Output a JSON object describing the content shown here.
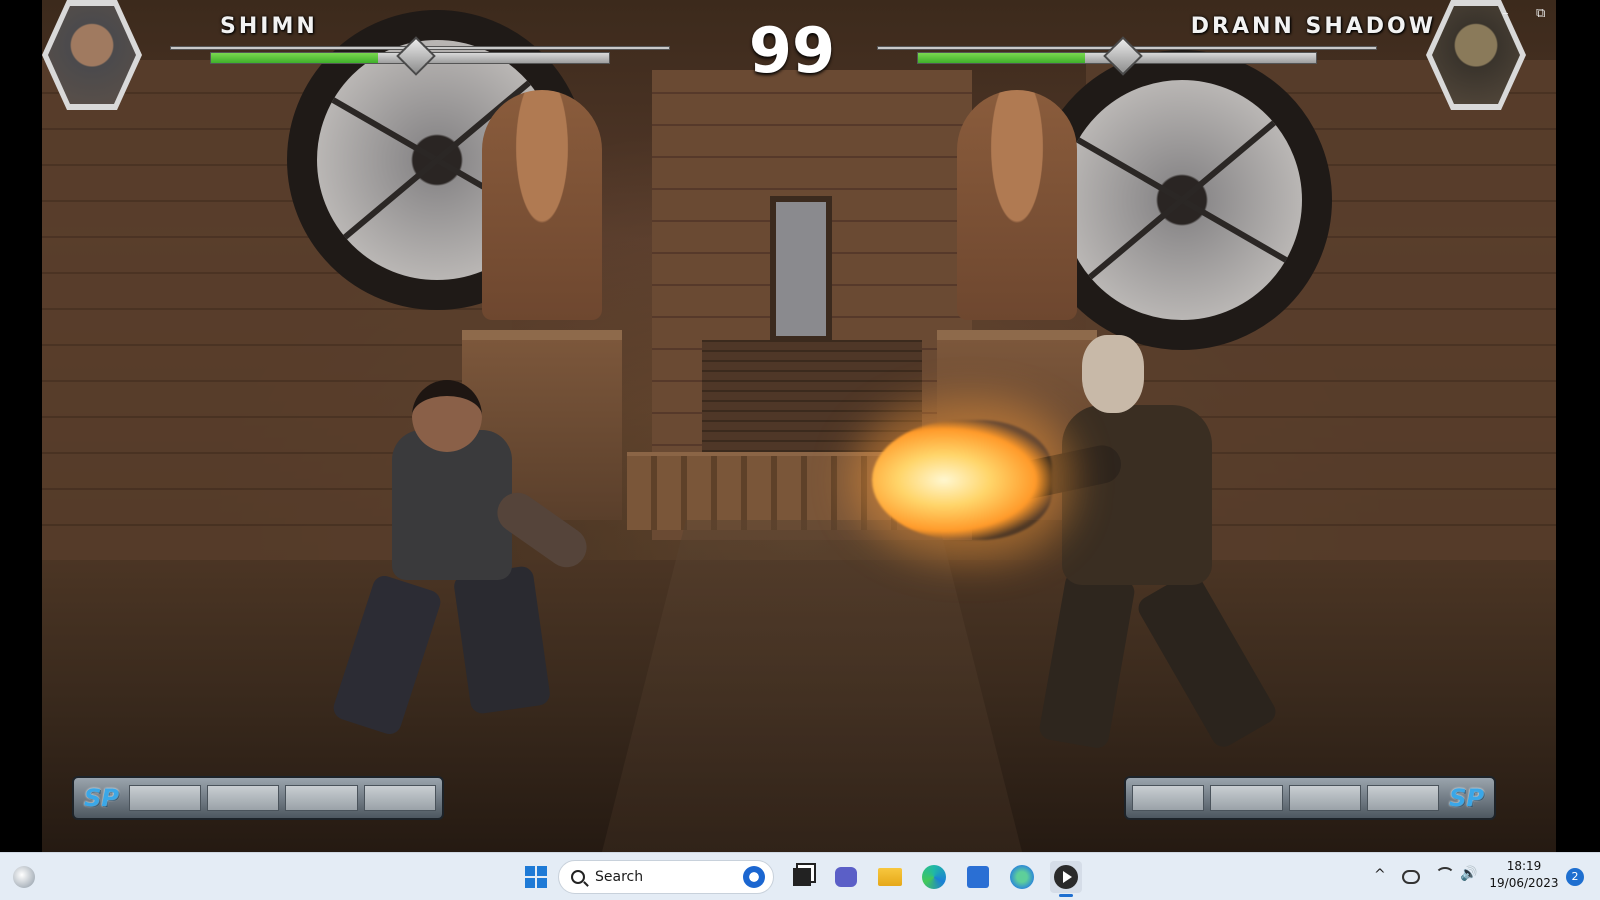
{
  "game": {
    "player1": {
      "name": "SHIMN",
      "health_fraction": 0.42
    },
    "player2": {
      "name": "DRANN SHADOW",
      "health_fraction": 0.42
    },
    "timer": "99",
    "sp_label": "SP",
    "sp_segments": 4
  },
  "window_controls": {
    "minimize": "–",
    "restore": "⧉",
    "close": "✕"
  },
  "taskbar": {
    "search_label": "Search",
    "icons": [
      "weather-icon",
      "start-icon",
      "search-icon",
      "task-view-icon",
      "teams-chat-icon",
      "file-explorer-icon",
      "edge-icon",
      "store-icon",
      "app-icon",
      "media-player-icon"
    ],
    "tray": {
      "chevron": "^",
      "volume": "🔊"
    },
    "clock": {
      "time": "18:19",
      "date": "19/06/2023"
    },
    "notification_count": "2"
  },
  "colors": {
    "health": "#3fb02a",
    "sp_text": "#3aa7e8",
    "taskbar_bg": "#e4ecf5"
  }
}
